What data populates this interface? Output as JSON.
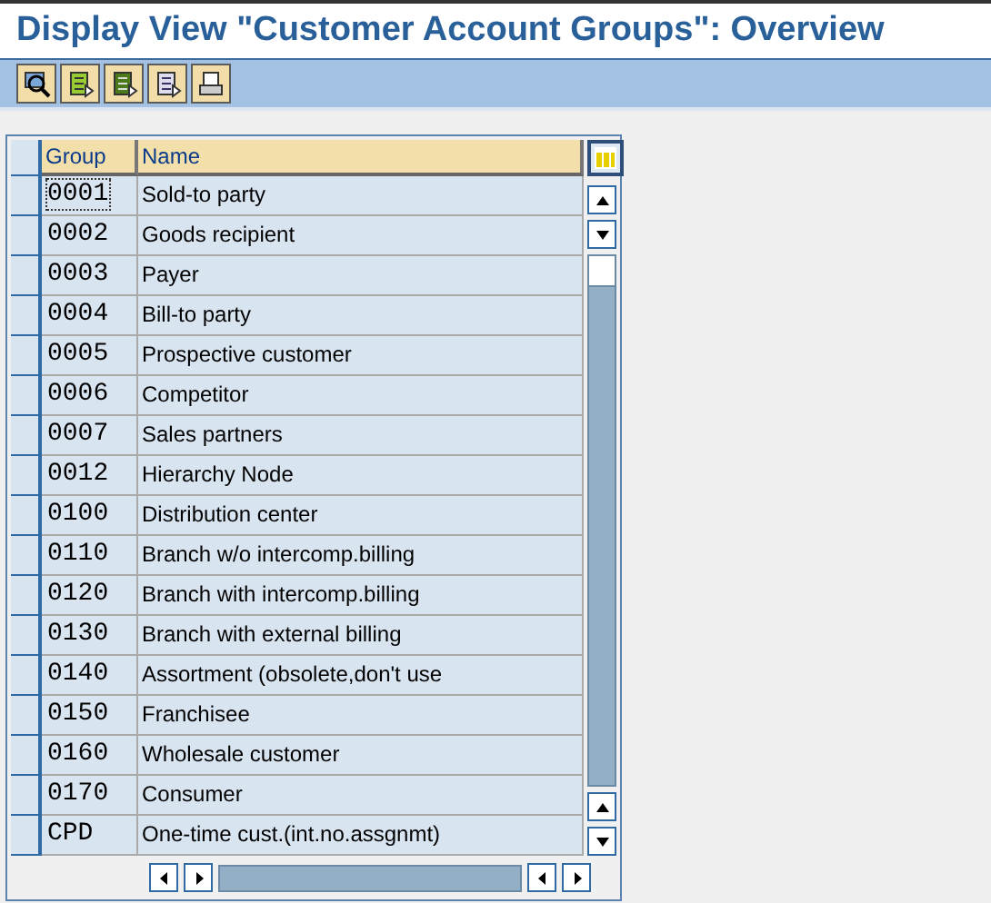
{
  "window": {
    "title": "Display View \"Customer Account Groups\": Overview"
  },
  "toolbar": [
    {
      "kind": "magnifier"
    },
    {
      "kind": "sheet-green"
    },
    {
      "kind": "sheet-darkgreen"
    },
    {
      "kind": "sheet-blue"
    },
    {
      "kind": "printer"
    }
  ],
  "table": {
    "columns": [
      "Group",
      "Name"
    ],
    "rows": [
      {
        "group": "0001",
        "name": "Sold-to party",
        "focused": true
      },
      {
        "group": "0002",
        "name": "Goods recipient",
        "focused": false
      },
      {
        "group": "0003",
        "name": "Payer",
        "focused": false
      },
      {
        "group": "0004",
        "name": "Bill-to party",
        "focused": false
      },
      {
        "group": "0005",
        "name": "Prospective customer",
        "focused": false
      },
      {
        "group": "0006",
        "name": "Competitor",
        "focused": false
      },
      {
        "group": "0007",
        "name": "Sales partners",
        "focused": false
      },
      {
        "group": "0012",
        "name": "Hierarchy Node",
        "focused": false
      },
      {
        "group": "0100",
        "name": "Distribution center",
        "focused": false
      },
      {
        "group": "0110",
        "name": "Branch w/o intercomp.billing",
        "focused": false
      },
      {
        "group": "0120",
        "name": "Branch with intercomp.billing",
        "focused": false
      },
      {
        "group": "0130",
        "name": "Branch with external billing",
        "focused": false
      },
      {
        "group": "0140",
        "name": "Assortment (obsolete,don't use",
        "focused": false
      },
      {
        "group": "0150",
        "name": "Franchisee",
        "focused": false
      },
      {
        "group": "0160",
        "name": "Wholesale customer",
        "focused": false
      },
      {
        "group": "0170",
        "name": "Consumer",
        "focused": false
      },
      {
        "group": "CPD",
        "name": "One-time cust.(int.no.assgnmt)",
        "focused": false
      }
    ]
  }
}
